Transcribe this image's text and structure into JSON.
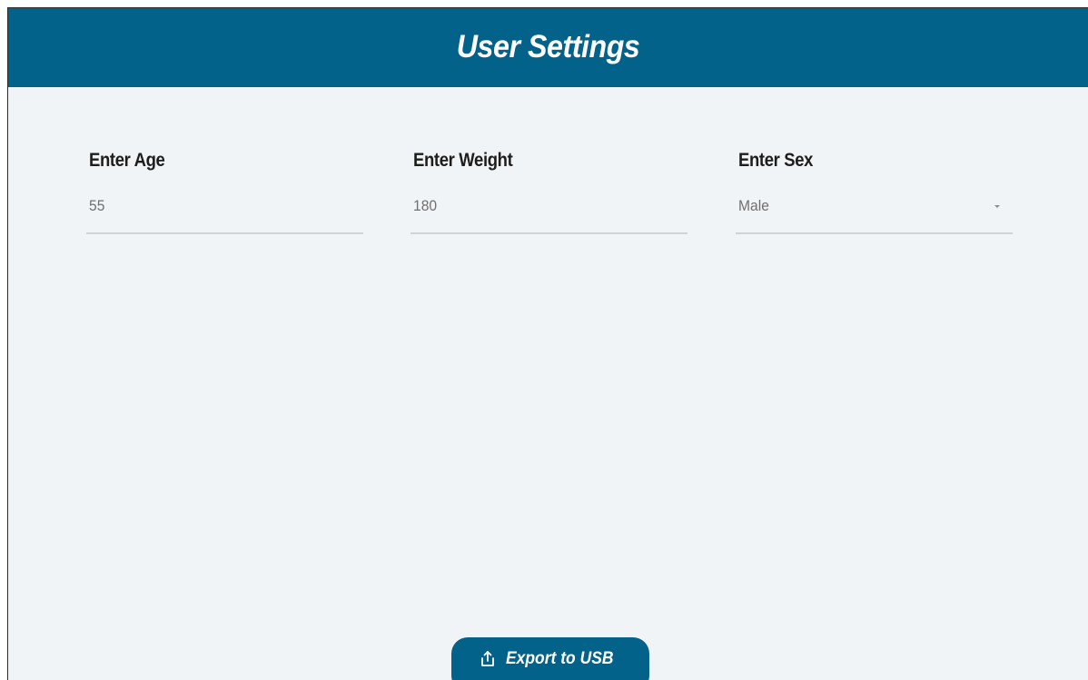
{
  "header": {
    "title": "User Settings"
  },
  "fields": {
    "age": {
      "label": "Enter Age",
      "value": "55"
    },
    "weight": {
      "label": "Enter Weight",
      "value": "180"
    },
    "sex": {
      "label": "Enter Sex",
      "value": "Male"
    }
  },
  "export_button": {
    "label": "Export to USB",
    "icon": "share-upload-icon"
  },
  "colors": {
    "header_bg": "#03628a",
    "body_bg": "#f1f4f7",
    "button_bg": "#03628a",
    "label_text": "#1d1d1d",
    "value_text": "#6f6f6f",
    "underline": "#cfd3d7"
  }
}
